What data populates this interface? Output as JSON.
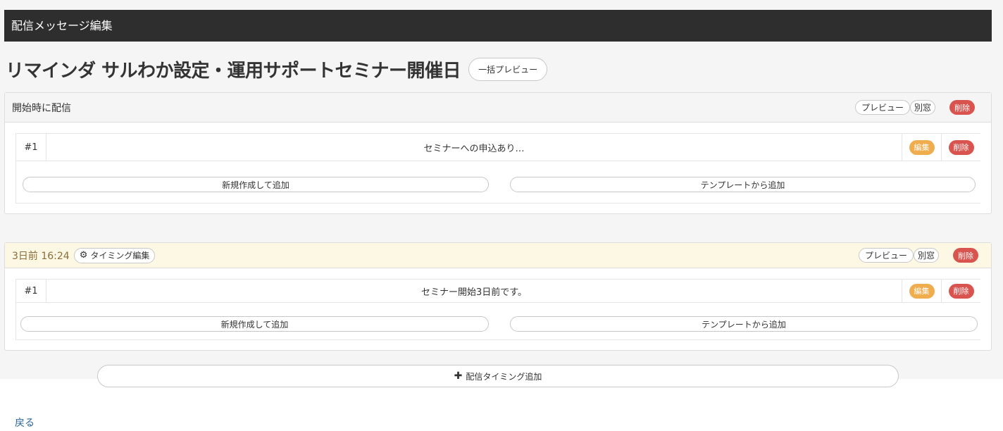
{
  "header": {
    "title": "配信メッセージ編集"
  },
  "page": {
    "title": "リマインダ サルわか設定・運用サポートセミナー開催日",
    "bulk_preview_label": "一括プレビュー"
  },
  "sections": [
    {
      "title": "開始時に配信",
      "preview_label": "プレビュー",
      "separate_window_label": "別窓",
      "delete_label": "削除",
      "messages": [
        {
          "num": "#1",
          "text": "セミナーへの申込あり…",
          "edit_label": "編集",
          "delete_label": "削除"
        }
      ],
      "add_new_label": "新規作成して追加",
      "add_template_label": "テンプレートから追加"
    },
    {
      "title": "3日前 16:24",
      "timing_edit_label": "タイミング編集",
      "preview_label": "プレビュー",
      "separate_window_label": "別窓",
      "delete_label": "削除",
      "messages": [
        {
          "num": "#1",
          "text": "セミナー開始3日前です。",
          "edit_label": "編集",
          "delete_label": "削除"
        }
      ],
      "add_new_label": "新規作成して追加",
      "add_template_label": "テンプレートから追加"
    }
  ],
  "add_timing_label": "配信タイミング追加",
  "back_label": "戻る",
  "icons": {
    "timing_edit": "gear-icon",
    "add_timing": "plus-icon"
  },
  "colors": {
    "header_bg": "#2e2e2e",
    "danger": "#d9534f",
    "warning": "#f0ad4e",
    "timing_bg": "#fcf8e3",
    "timing_text": "#8a6d3b",
    "link": "#2a6496"
  }
}
